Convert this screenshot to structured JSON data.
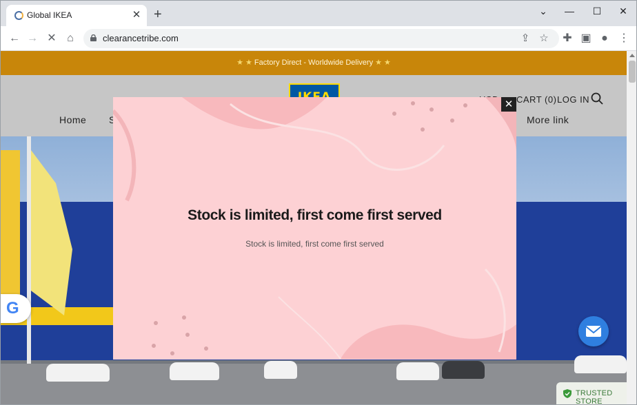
{
  "browser": {
    "tab_title": "Global IKEA",
    "new_tab_symbol": "+",
    "tab_close_symbol": "✕",
    "url": "clearancetribe.com",
    "window_controls": [
      "⌄",
      "—",
      "☐",
      "✕"
    ]
  },
  "store": {
    "announcement": "Factory Direct - Worldwide Delivery",
    "logo_text": "IKEA",
    "header_links": {
      "currency": "USD",
      "cart": "CART (0)",
      "login": "LOG IN"
    },
    "nav": [
      "Home",
      "S",
      "More link"
    ],
    "google_letter": "G",
    "trusted_store": "TRUSTED STORE"
  },
  "modal": {
    "title": "Stock is limited, first come first served",
    "subtitle": "Stock is limited, first come first served",
    "close_symbol": "✕"
  },
  "colors": {
    "announcement_bg": "#c8860a",
    "modal_bg": "#fdd1d4",
    "chat_button": "#2f7fe0",
    "ikea_blue": "#0058a3",
    "ikea_yellow": "#ffdb00"
  }
}
